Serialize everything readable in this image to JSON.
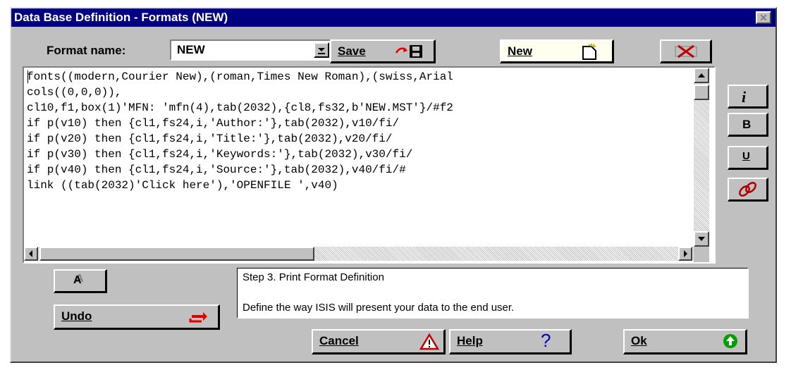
{
  "window": {
    "title": "Data Base Definition - Formats (NEW)"
  },
  "format": {
    "label": "Format name:",
    "value": "NEW"
  },
  "buttons": {
    "save": "Save",
    "new": "New",
    "undo": "Undo",
    "cancel": "Cancel",
    "help": "Help",
    "ok": "Ok",
    "italic": "i",
    "bold": "B",
    "underline": "U",
    "font": "A"
  },
  "editor": {
    "lines": [
      "fonts((modern,Courier New),(roman,Times New Roman),(swiss,Arial",
      "cols((0,0,0)),",
      "cl10,f1,box(1)'MFN: 'mfn(4),tab(2032),{cl8,fs32,b'NEW.MST'}/#f2",
      "if p(v10) then {cl1,fs24,i,'Author:'},tab(2032),v10/fi/",
      "if p(v20) then {cl1,fs24,i,'Title:'},tab(2032),v20/fi/",
      "if p(v30) then {cl1,fs24,i,'Keywords:'},tab(2032),v30/fi/",
      "if p(v40) then {cl1,fs24,i,'Source:'},tab(2032),v40/fi/#",
      "link ((tab(2032)'Click here'),'OPENFILE ',v40)"
    ]
  },
  "info": {
    "step": "Step 3. Print Format Definition",
    "description": "Define the way ISIS will present your data to the end user."
  },
  "icons": [
    "close-icon",
    "dropdown-arrow-icon",
    "save-disk-icon",
    "new-document-icon",
    "delete-x-icon",
    "link-icon",
    "undo-arrow-icon",
    "warning-icon",
    "help-question-icon",
    "ok-green-arrow-icon"
  ],
  "colors": {
    "titlebar": "#000080",
    "face": "#c0c0c0",
    "new_button": "#fffff0",
    "ok_icon": "#00a000",
    "undo_icon": "#e00000"
  }
}
